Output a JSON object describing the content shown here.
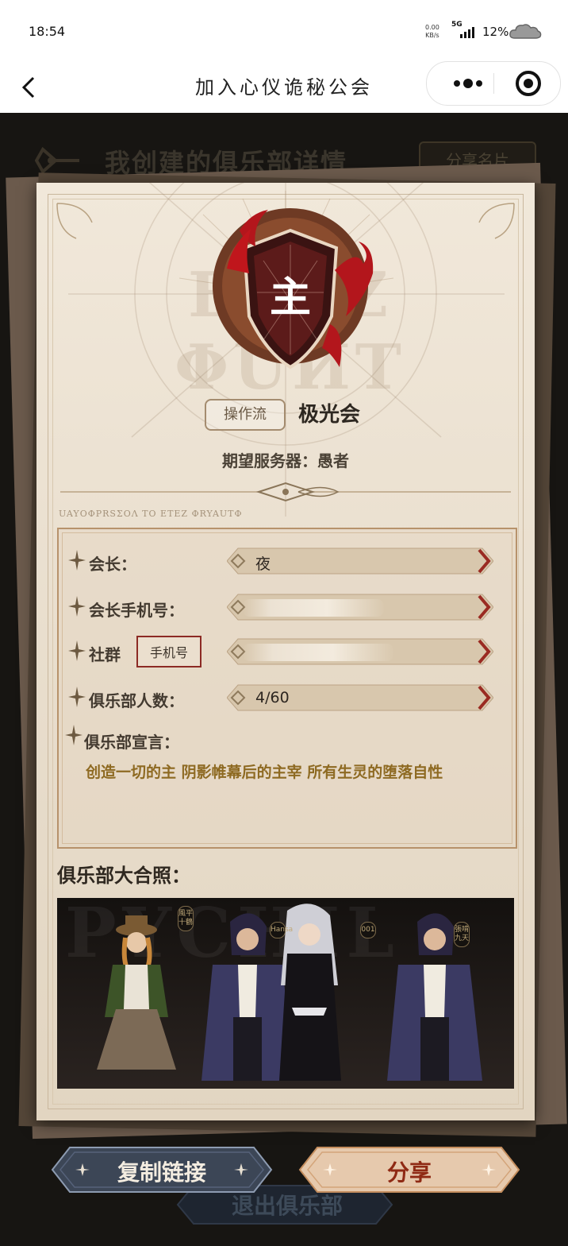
{
  "status_bar": {
    "time": "18:54",
    "net_speed_value": "0.00",
    "net_speed_unit": "KB/s",
    "network": "5G",
    "battery": "12%"
  },
  "nav": {
    "title": "加入心仪诡秘公会"
  },
  "header": {
    "title": "我创建的俱乐部详情",
    "share_card_label": "分享名片"
  },
  "club": {
    "emblem_char": "主",
    "style_tag": "操作流",
    "name": "极光会",
    "server_label": "期望服务器：愚者",
    "watermark_text": "ETEZ  ΦUИT",
    "cipher_line": "UAYOΦPRSΣOΛ TO ETEZ ΦRYAUTΦ"
  },
  "info": {
    "president_label": "会长：",
    "president_value": "夜",
    "president_phone_label": "会长手机号：",
    "community_label": "社群",
    "community_type": "手机号",
    "members_label": "俱乐部人数：",
    "members_value": "4/60",
    "declaration_label": "俱乐部宣言：",
    "declaration_text": "创造一切的主 阴影帷幕后的主宰 所有生灵的堕落自性"
  },
  "photo": {
    "label": "俱乐部大合照：",
    "bg_text": "PYCHIL",
    "tags": [
      "風平十鶴",
      "Hansa",
      "001",
      "張啃九天"
    ]
  },
  "buttons": {
    "copy_link": "复制链接",
    "share": "分享",
    "exit": "退出俱乐部"
  },
  "colors": {
    "card_bg": "#efe6d8",
    "accent_red": "#8c2a24",
    "gold": "#8e6a22",
    "copy_btn": "#3c4656",
    "share_btn": "#e6c9ad"
  }
}
